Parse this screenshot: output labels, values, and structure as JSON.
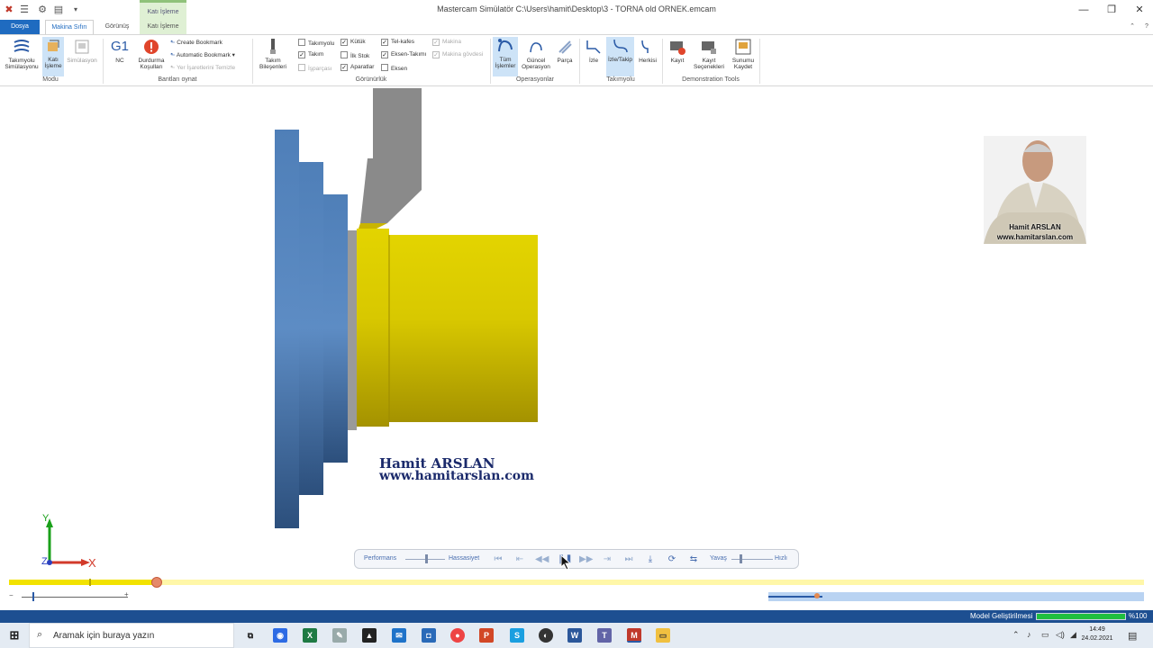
{
  "window": {
    "title": "Mastercam Simülatör C:\\Users\\hamit\\Desktop\\3 - TORNA old ORNEK.emcam",
    "context_group": "Katı İşleme",
    "minimize": "—",
    "restore": "❐",
    "close": "✕"
  },
  "tabs": {
    "file": "Dosya",
    "machine": "Makina Sıfırı",
    "view": "Görünüş",
    "solid": "Katı İşleme"
  },
  "ribbon": {
    "mode": {
      "group_label": "Modu",
      "toolpath_sim": "Takımyolu Simülasyonu",
      "solid": "Katı İşleme",
      "simulation": "Simülasyon"
    },
    "bookmarks": {
      "group_label": "Bantları oynat",
      "nc": "NC",
      "stop_conditions": "Durdurma Koşulları",
      "create_bookmark": "Create Bookmark",
      "auto_bookmark": "Automatic Bookmark",
      "clear_marks": "Yer İşaretlerini Temizle"
    },
    "visibility": {
      "group_label": "Görünürlük",
      "components": "Takım Bileşenleri",
      "checks": [
        {
          "label": "Takımyolu",
          "checked": false,
          "dim": false
        },
        {
          "label": "Takım",
          "checked": true,
          "dim": false
        },
        {
          "label": "İşparçası",
          "checked": false,
          "dim": true
        },
        {
          "label": "Kütük",
          "checked": true,
          "dim": false
        },
        {
          "label": "İlk Stok",
          "checked": false,
          "dim": false
        },
        {
          "label": "Aparatlar",
          "checked": true,
          "dim": false
        },
        {
          "label": "Tel-kafes",
          "checked": true,
          "dim": false
        },
        {
          "label": "Eksen-Takımı",
          "checked": true,
          "dim": false
        },
        {
          "label": "Eksen",
          "checked": false,
          "dim": false
        },
        {
          "label": "Makina",
          "checked": true,
          "dim": true
        },
        {
          "label": "Makina gövdesi",
          "checked": true,
          "dim": true
        }
      ]
    },
    "operations": {
      "group_label": "Operasyonlar",
      "all": "Tüm İşlemler",
      "current": "Güncel Operasyon",
      "part": "Parça"
    },
    "toolpath": {
      "group_label": "Takımyolu",
      "trace": "İzle",
      "trace_follow": "İzle/Takip",
      "hide": "Herkisi"
    },
    "demo": {
      "group_label": "Demonstration Tools",
      "record": "Kayıt",
      "record_options": "Kayıt Seçenekleri",
      "save_presentation": "Sunumu Kaydet"
    }
  },
  "viewport": {
    "watermark_name": "Hamit  ARSLAN",
    "watermark_url": "www.hamitarslan.com",
    "presenter_name": "Hamit ARSLAN",
    "presenter_url": "www.hamitarslan.com",
    "axis_x": "X",
    "axis_y": "Y",
    "axis_z": "Z",
    "colors": {
      "part": "#e3d400",
      "chuck": "#4f7fb8",
      "tool": "#8a8a8a"
    }
  },
  "sim_toolbar": {
    "performance": "Performans",
    "precision": "Hassasiyet",
    "slow": "Yavaş",
    "fast": "Hızlı",
    "performance_level": 0.5,
    "speed_level": 0.2
  },
  "timeline": {
    "progress": 0.13,
    "zoom_minus": "−",
    "zoom_plus": "+"
  },
  "status": {
    "label": "Model Geliştirilmesi",
    "progress": 100,
    "percent_text": "%100"
  },
  "taskbar": {
    "search_placeholder": "Aramak için buraya yazın",
    "time": "14:49",
    "date": "24.02.2021"
  }
}
